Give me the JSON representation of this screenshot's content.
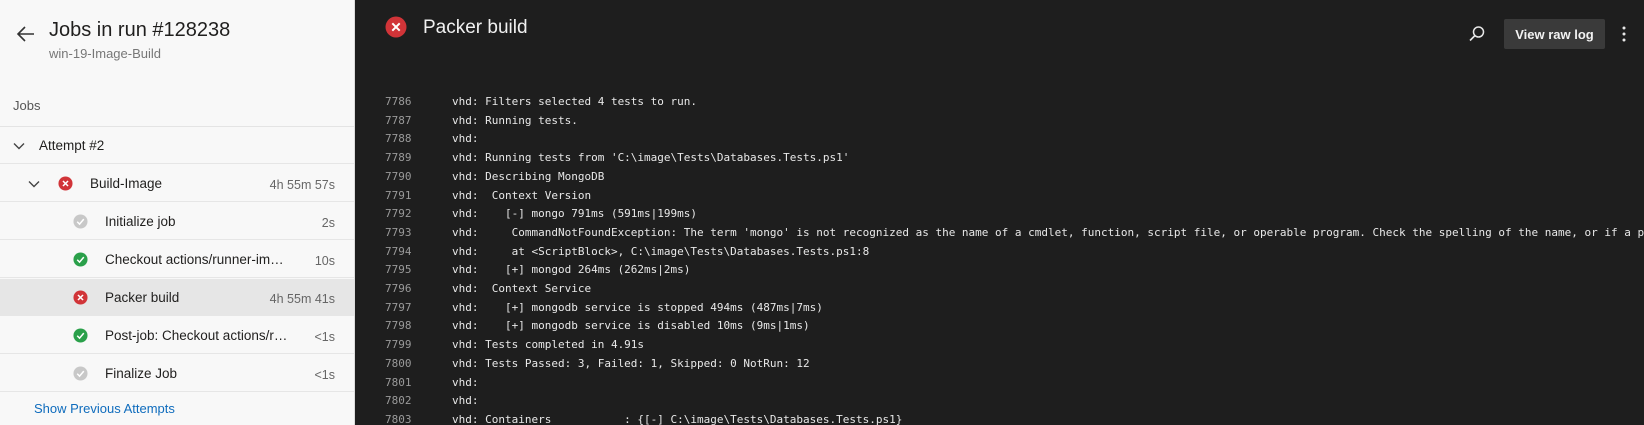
{
  "header": {
    "title": "Jobs in run #128238",
    "subtitle": "win-19-Image-Build"
  },
  "jobs_section_label": "Jobs",
  "attempt": {
    "label": "Attempt #2"
  },
  "job": {
    "label": "Build-Image",
    "duration": "4h 55m 57s",
    "status": "failed"
  },
  "steps": [
    {
      "label": "Initialize job",
      "duration": "2s",
      "status": "skipped"
    },
    {
      "label": "Checkout actions/runner-images",
      "duration": "10s",
      "status": "succeeded"
    },
    {
      "label": "Packer build",
      "duration": "4h 55m 41s",
      "status": "failed"
    },
    {
      "label": "Post-job: Checkout actions/runner-images",
      "duration": "<1s",
      "status": "succeeded"
    },
    {
      "label": "Finalize Job",
      "duration": "<1s",
      "status": "skipped"
    }
  ],
  "show_previous_label": "Show Previous Attempts",
  "log_panel": {
    "title": "Packer build",
    "view_raw_label": "View raw log"
  },
  "colors": {
    "failed": "#d13438",
    "succeeded": "#2aa04a",
    "skipped": "#c8c8c8",
    "link": "#0f6cbd"
  },
  "log_lines": [
    {
      "num": "7786",
      "text": "vhd: Filters selected 4 tests to run."
    },
    {
      "num": "7787",
      "text": "vhd: Running tests."
    },
    {
      "num": "7788",
      "text": "vhd:"
    },
    {
      "num": "7789",
      "text": "vhd: Running tests from 'C:\\image\\Tests\\Databases.Tests.ps1'"
    },
    {
      "num": "7790",
      "text": "vhd: Describing MongoDB"
    },
    {
      "num": "7791",
      "text": "vhd:  Context Version"
    },
    {
      "num": "7792",
      "text": "vhd:    [-] mongo 791ms (591ms|199ms)"
    },
    {
      "num": "7793",
      "text": "vhd:     CommandNotFoundException: The term 'mongo' is not recognized as the name of a cmdlet, function, script file, or operable program. Check the spelling of the name, or if a path was inclu"
    },
    {
      "num": "7794",
      "text": "vhd:     at <ScriptBlock>, C:\\image\\Tests\\Databases.Tests.ps1:8"
    },
    {
      "num": "7795",
      "text": "vhd:    [+] mongod 264ms (262ms|2ms)"
    },
    {
      "num": "7796",
      "text": "vhd:  Context Service"
    },
    {
      "num": "7797",
      "text": "vhd:    [+] mongodb service is stopped 494ms (487ms|7ms)"
    },
    {
      "num": "7798",
      "text": "vhd:    [+] mongodb service is disabled 10ms (9ms|1ms)"
    },
    {
      "num": "7799",
      "text": "vhd: Tests completed in 4.91s"
    },
    {
      "num": "7800",
      "text": "vhd: Tests Passed: 3, Failed: 1, Skipped: 0 NotRun: 12"
    },
    {
      "num": "7801",
      "text": "vhd:"
    },
    {
      "num": "7802",
      "text": "vhd:"
    },
    {
      "num": "7803",
      "text": "vhd: Containers           : {[-] C:\\image\\Tests\\Databases.Tests.ps1}"
    }
  ]
}
